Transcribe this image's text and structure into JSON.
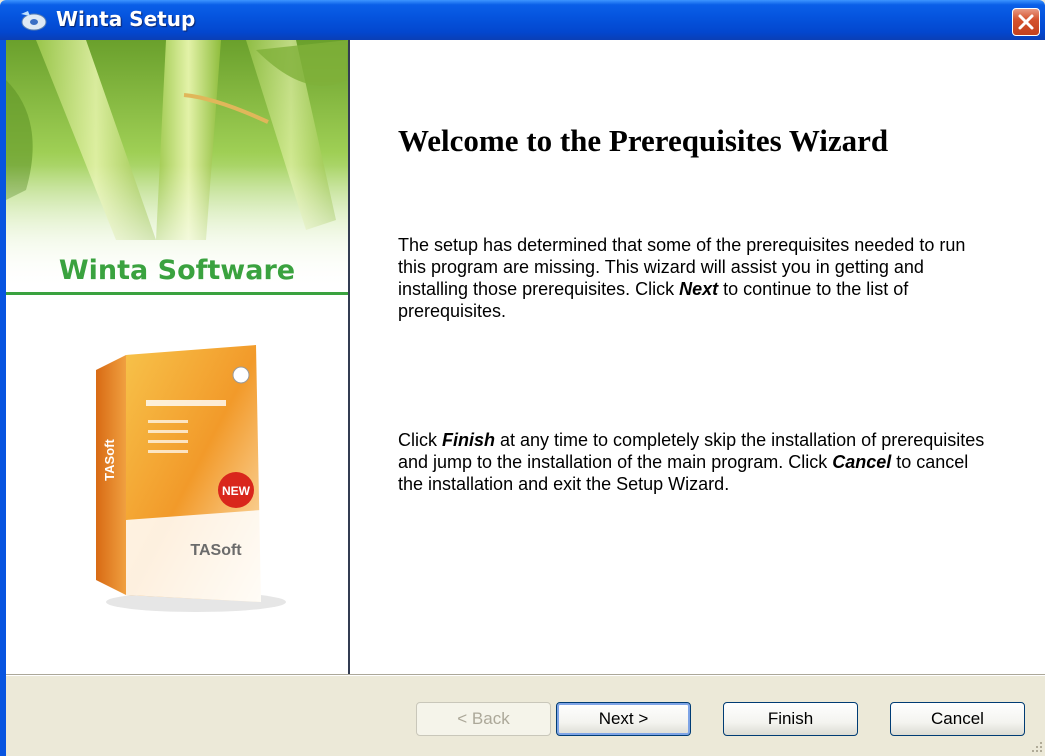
{
  "window": {
    "title": "Winta Setup",
    "icon": "setup-disc-icon",
    "close_icon": "close-icon"
  },
  "banner": {
    "brand": "Winta Software",
    "box_brand": "TASoft",
    "box_side_brand": "TASoft",
    "box_badge": "NEW"
  },
  "content": {
    "heading": "Welcome to the Prerequisites Wizard",
    "para1_before_next": "The setup has determined that some of the prerequisites needed to run this program are missing. This wizard will assist you in getting and installing those prerequisites. Click ",
    "para1_next": "Next",
    "para1_after_next": "  to continue to the list of prerequisites.",
    "para2_click": "Click ",
    "para2_finish": "Finish",
    "para2_middle": " at any time to completely skip the installation of prerequisites and jump to the installation of the main program. Click ",
    "para2_cancel": "Cancel",
    "para2_end": " to cancel the installation and exit the Setup Wizard."
  },
  "buttons": {
    "back": "< Back",
    "next": "Next >",
    "finish": "Finish",
    "cancel": "Cancel"
  },
  "colors": {
    "titlebar": "#0553dd",
    "brand_green": "#3aa23f",
    "close_red": "#d5532f",
    "dialog_bg": "#ece9d8"
  }
}
